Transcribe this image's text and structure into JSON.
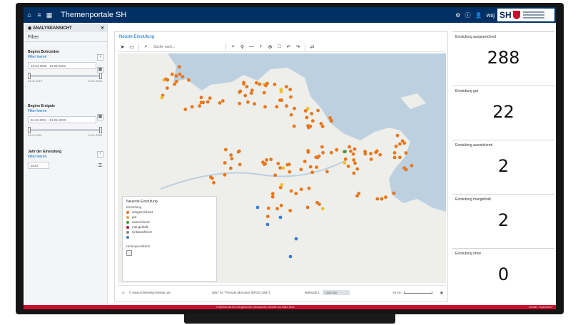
{
  "app": {
    "title": "Themenportale SH",
    "logo_text": "SH"
  },
  "topbar": {
    "left_icons": [
      "home-icon",
      "list-icon",
      "grid-icon"
    ],
    "right_icons": [
      "settings-icon",
      "info-icon",
      "user-icon"
    ],
    "user_label": "wsj"
  },
  "filter": {
    "panel_header": "ANALYSEANSICHT",
    "title": "Filter",
    "sections": [
      {
        "label": "Beginn Bohrzeiten",
        "link": "Filter loeren",
        "input": "15.01.2020 - 16.01.2022",
        "min": "01.01.2019",
        "max": "11.01.2023"
      },
      {
        "label": "Beginn Ereignis",
        "link": "Filter loeren",
        "input": "01.01.2021 - 01.01.2023",
        "min": "01.01.2021",
        "max": "11.01.2023"
      },
      {
        "label": "Jahr der Einstufung",
        "link": "Filter loeren",
        "input": "2023"
      }
    ]
  },
  "map": {
    "title": "Neuste Einstufung",
    "search_placeholder": "Suche nach...",
    "legend": {
      "title": "Neueste Einstufung",
      "subtitle": "Einstufung",
      "items": [
        {
          "label": "ausgezeichnet",
          "color": "#e8761a"
        },
        {
          "label": "gut",
          "color": "#f0a22a"
        },
        {
          "label": "ausreichend",
          "color": "#3f9c3a"
        },
        {
          "label": "mangelhaft",
          "color": "#c8102e"
        },
        {
          "label": "Unklassifiziert",
          "color": "#888888"
        },
        {
          "label": "-",
          "color": "#3d7fd0"
        }
      ],
      "background_label": "Hintergrundkarte"
    },
    "footer": {
      "source": "© www.schleswig-holstein.de",
      "crs": "3857 (in °Pseudo Mercator (EPSG:3857)",
      "scale_label": "Maßstab 1:",
      "scale_value": "1:850.000",
      "scale_unit": "20 km"
    }
  },
  "kpis": [
    {
      "label": "Einstufung ausgezeichnet",
      "value": "288"
    },
    {
      "label": "Einstufung gut",
      "value": "22"
    },
    {
      "label": "Einstufung ausreichend",
      "value": "2"
    },
    {
      "label": "Einstufung mangelhaft",
      "value": "2"
    },
    {
      "label": "Einstufung ohne",
      "value": "0"
    }
  ],
  "footer": {
    "left": "© Ministerium für Energiewende, Klimaschutz, Umwelt und Natur 2023",
    "right": "Kontakt · Impressum"
  }
}
